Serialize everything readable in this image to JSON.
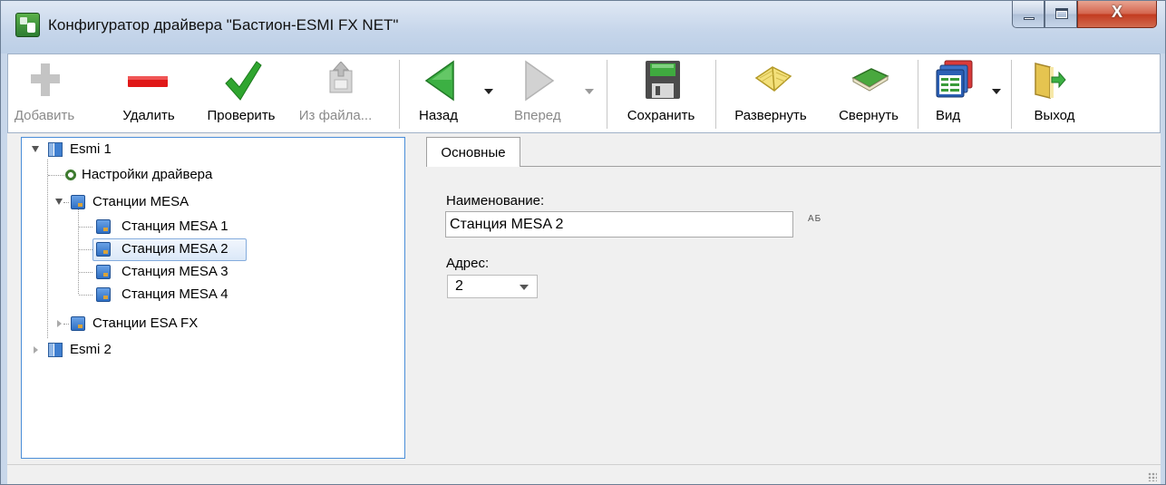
{
  "window": {
    "title": "Конфигуратор драйвера \"Бастион-ESMI FX NET\"",
    "controls": {
      "close_glyph": "X"
    }
  },
  "toolbar": {
    "add_label": "Добавить",
    "delete_label": "Удалить",
    "check_label": "Проверить",
    "from_file_label": "Из файла...",
    "back_label": "Назад",
    "forward_label": "Вперед",
    "save_label": "Сохранить",
    "expand_label": "Развернуть",
    "collapse_label": "Свернуть",
    "view_label": "Вид",
    "exit_label": "Выход"
  },
  "tree": {
    "nodes": [
      {
        "label": "Esmi 1",
        "expanded": true
      },
      {
        "label": "Настройки драйвера"
      },
      {
        "label": "Станции MESA",
        "expanded": true
      },
      {
        "label": "Станция MESA 1"
      },
      {
        "label": "Станция MESA 2",
        "selected": true
      },
      {
        "label": "Станция MESA 3"
      },
      {
        "label": "Станция MESA 4"
      },
      {
        "label": "Станции ESA FX",
        "expanded": false
      },
      {
        "label": "Esmi 2",
        "expanded": false
      }
    ]
  },
  "details": {
    "tab_label": "Основные",
    "name_label": "Наименование:",
    "name_value": "Станция MESA 2",
    "translit_icon_text": "АБ",
    "address_label": "Адрес:",
    "address_value": "2"
  },
  "colors": {
    "accent": "#4a8ed8",
    "selection": "#dbe8f8",
    "delete_red": "#e01818",
    "check_green": "#2fa52f"
  }
}
